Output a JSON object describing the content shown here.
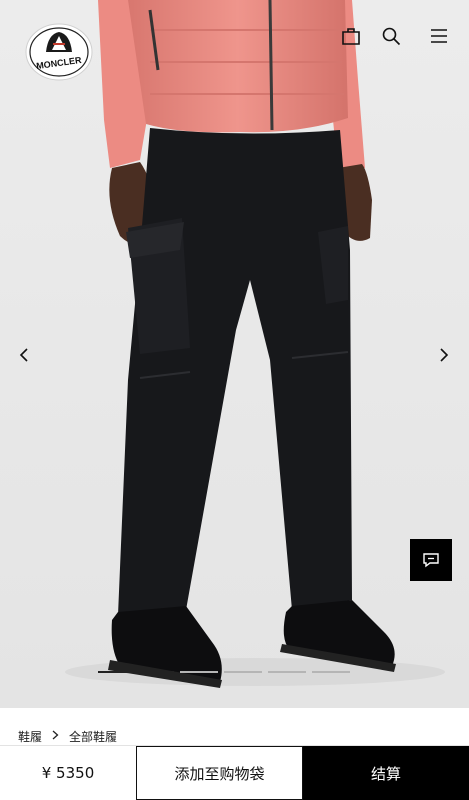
{
  "header": {
    "brand": "MONCLER",
    "icons": [
      "shopping-bag-icon",
      "search-icon",
      "menu-icon"
    ]
  },
  "carousel": {
    "slides_total": 5,
    "active_slide": 1
  },
  "breadcrumb": {
    "items": [
      "鞋履",
      "全部鞋履"
    ]
  },
  "purchase": {
    "price": "¥ 5350",
    "add_to_bag_label": "添加至购物袋",
    "checkout_label": "结算"
  },
  "colors": {
    "jacket": "#e8877e",
    "pants": "#17181b",
    "background": "#ececec",
    "accent": "#000000"
  }
}
